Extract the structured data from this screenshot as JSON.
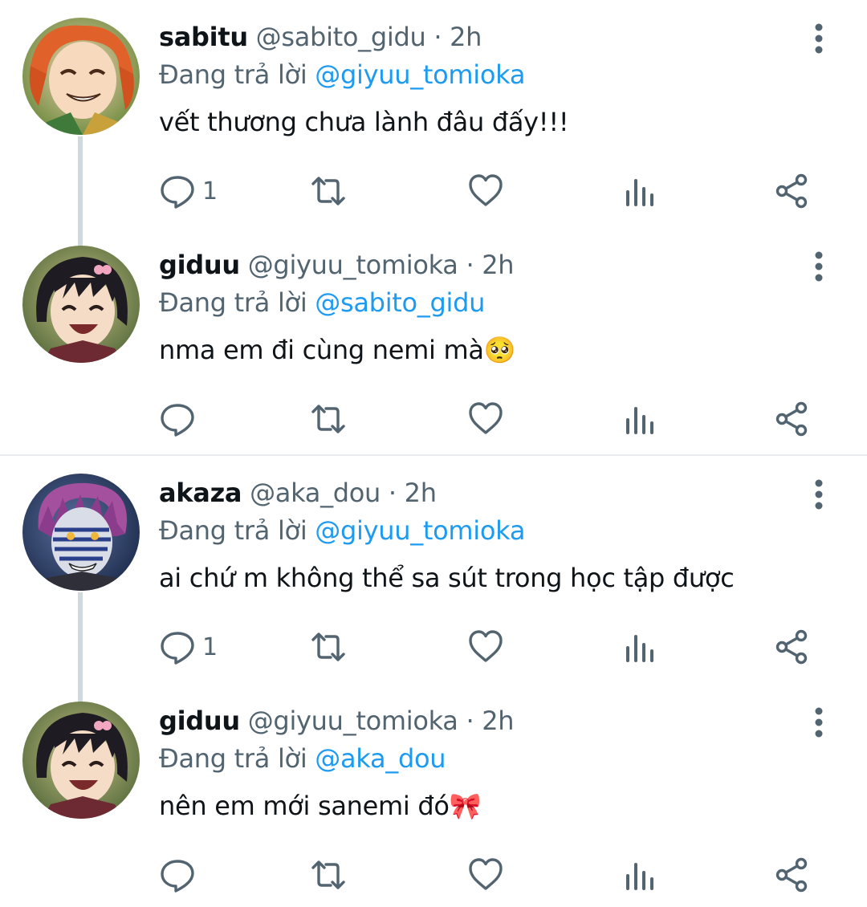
{
  "replying_prefix": "Đang trả lời",
  "tweets": [
    {
      "name": "sabitu",
      "handle": "@sabito_gidu",
      "separator_dot": "·",
      "time": "2h",
      "replying_to": "@giyuu_tomioka",
      "text": "vết thương chưa lành đâu đấy!!!",
      "reply_count": "1",
      "avatar": "orange-haired-smiling-character"
    },
    {
      "name": "giduu",
      "handle": "@giyuu_tomioka",
      "separator_dot": "·",
      "time": "2h",
      "replying_to": "@sabito_gidu",
      "text": "nma em đi cùng nemi mà🥺",
      "reply_count": "",
      "avatar": "dark-haired-laughing-character"
    },
    {
      "name": "akaza",
      "handle": "@aka_dou",
      "separator_dot": "·",
      "time": "2h",
      "replying_to": "@giyuu_tomioka",
      "text": "ai chứ m không thể sa sút trong học tập được",
      "reply_count": "1",
      "avatar": "pink-haired-tattooed-character"
    },
    {
      "name": "giduu",
      "handle": "@giyuu_tomioka",
      "separator_dot": "·",
      "time": "2h",
      "replying_to": "@aka_dou",
      "text": "nên em mới sanemi đó🎀",
      "reply_count": "",
      "avatar": "dark-haired-laughing-character"
    }
  ],
  "icons": {
    "reply": "reply-icon",
    "retweet": "retweet-icon",
    "like": "like-icon",
    "views": "views-icon",
    "share": "share-icon",
    "more": "more-options-icon"
  },
  "colors": {
    "link": "#1d9bf0",
    "secondary_text": "#536471",
    "thread_line": "#cfd9de",
    "separator": "#e7ebee"
  }
}
